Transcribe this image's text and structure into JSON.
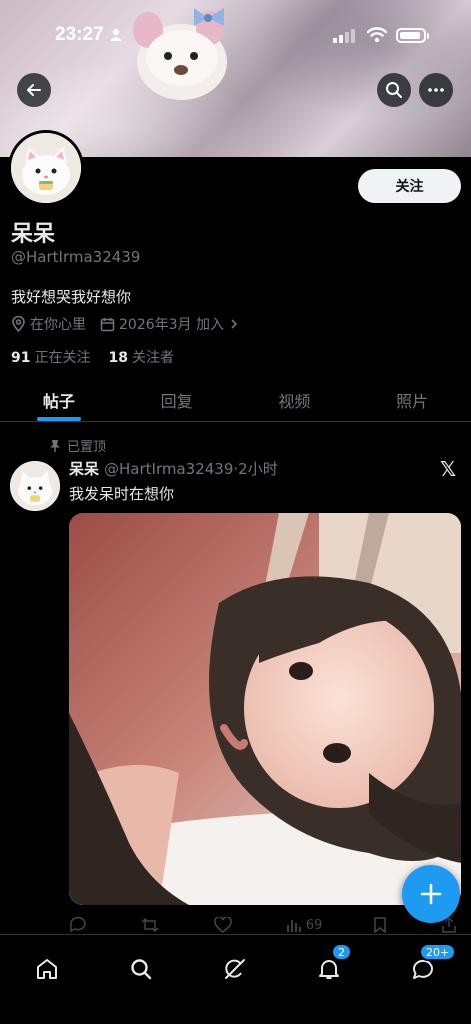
{
  "status_bar": {
    "time": "23:27"
  },
  "profile": {
    "display_name": "呆呆",
    "handle": "@HartIrma32439",
    "bio": "我好想哭我好想你",
    "location": "在你心里",
    "joined": "2026年3月 加入",
    "following_count": "91",
    "following_label": "正在关注",
    "followers_count": "18",
    "followers_label": "关注者",
    "follow_button": "关注"
  },
  "tabs": [
    {
      "label": "帖子",
      "active": true
    },
    {
      "label": "回复",
      "active": false
    },
    {
      "label": "视频",
      "active": false
    },
    {
      "label": "照片",
      "active": false
    }
  ],
  "pinned_post": {
    "pinned_label": "已置顶",
    "author_name": "呆呆",
    "author_handle": "@HartIrma32439",
    "time_ago": "·2小时",
    "text": "我发呆时在想你",
    "views": "69"
  },
  "bottom_nav": {
    "notifications_badge": "2",
    "messages_badge": "20+"
  },
  "colors": {
    "accent": "#1d9bf0",
    "background": "#000000",
    "text_primary": "#e7e9ea",
    "text_secondary": "#71767b"
  }
}
